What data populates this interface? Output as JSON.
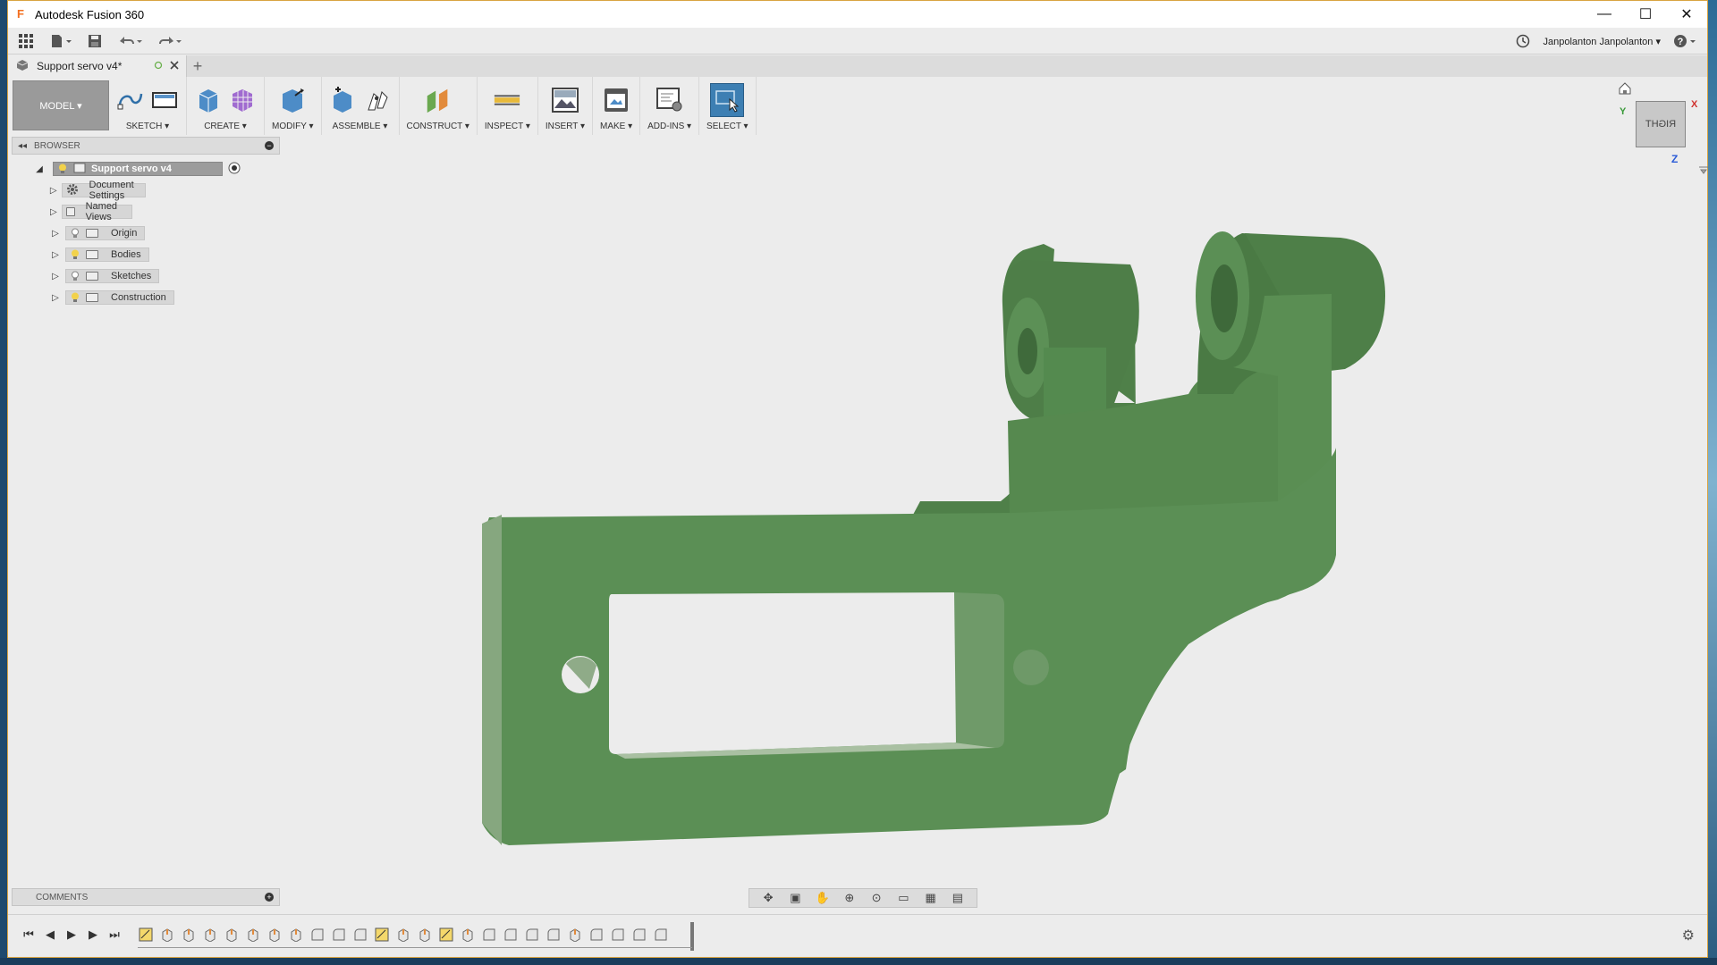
{
  "app": {
    "title": "Autodesk Fusion 360",
    "logo_letter": "F"
  },
  "window_controls": {
    "minimize": "—",
    "maximize": "☐",
    "close": "✕"
  },
  "quick_access": {
    "user_name": "Janpolanton Janpolanton ▾",
    "help": "?"
  },
  "document_tab": {
    "title": "Support servo v4*"
  },
  "toolbar": {
    "workspace": "MODEL ▾",
    "groups": [
      {
        "label": "SKETCH ▾"
      },
      {
        "label": "CREATE ▾"
      },
      {
        "label": "MODIFY ▾"
      },
      {
        "label": "ASSEMBLE ▾"
      },
      {
        "label": "CONSTRUCT ▾"
      },
      {
        "label": "INSPECT ▾"
      },
      {
        "label": "INSERT ▾"
      },
      {
        "label": "MAKE ▾"
      },
      {
        "label": "ADD-INS ▾"
      },
      {
        "label": "SELECT ▾"
      }
    ]
  },
  "browser": {
    "title": "BROWSER",
    "root": "Support servo v4",
    "items": [
      {
        "label": "Document Settings",
        "icon": "gear-icon"
      },
      {
        "label": "Named Views",
        "icon": "folder-icon"
      },
      {
        "label": "Origin",
        "icon": "folder-icon"
      },
      {
        "label": "Bodies",
        "icon": "folder-icon"
      },
      {
        "label": "Sketches",
        "icon": "folder-icon"
      },
      {
        "label": "Construction",
        "icon": "folder-icon"
      }
    ]
  },
  "comments": {
    "title": "COMMENTS"
  },
  "viewcube": {
    "face": "RIGHT",
    "axis_x": "X",
    "axis_y": "Y",
    "axis_z": "Z"
  },
  "colors": {
    "part_green": "#5a8f55",
    "part_dark": "#4b7a47",
    "part_light": "#7aa874",
    "active_tool": "#3d7fb3"
  }
}
